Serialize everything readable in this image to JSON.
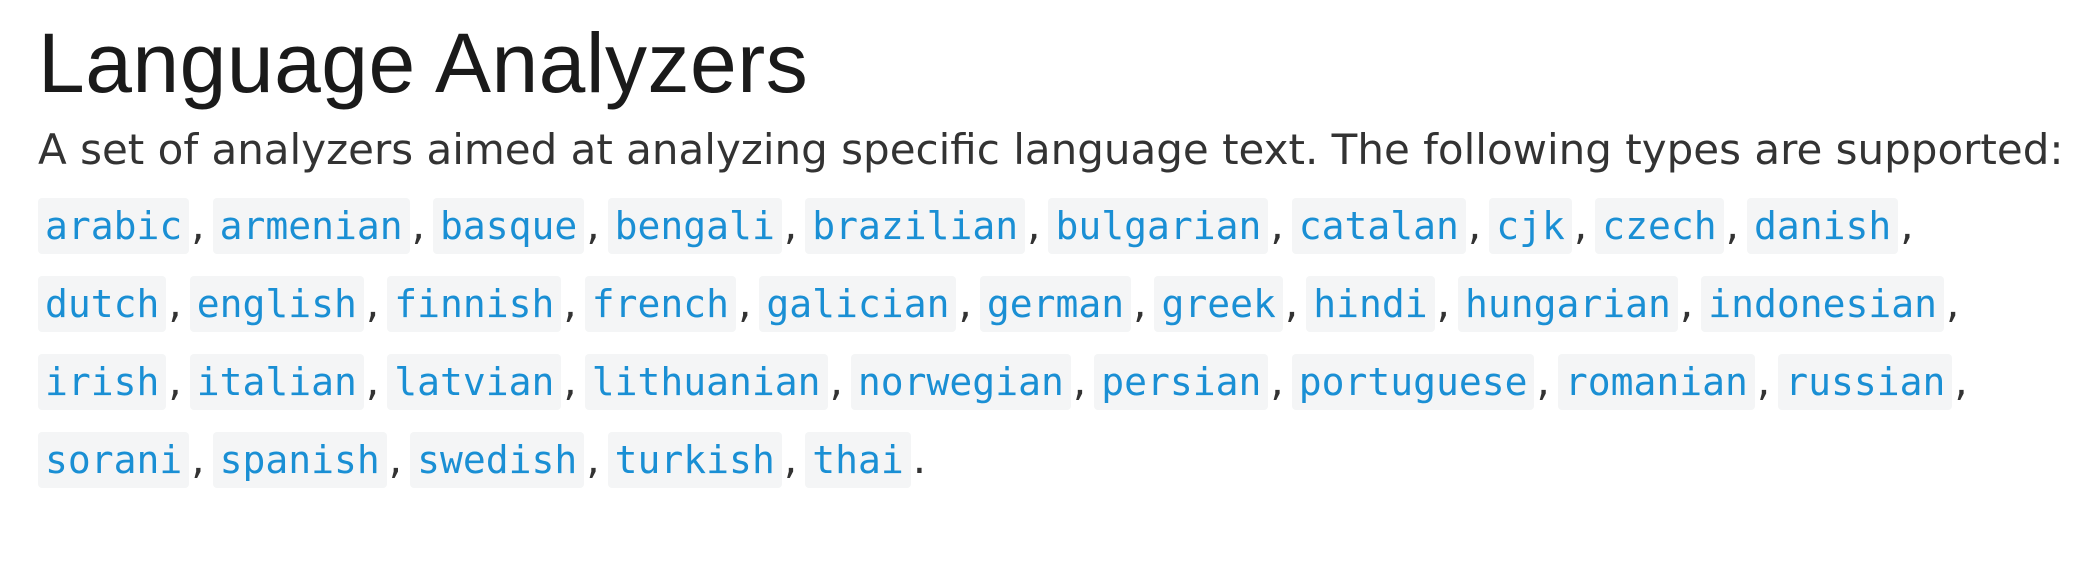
{
  "page": {
    "title": "Language Analyzers",
    "intro": "A set of analyzers aimed at analyzing specific language text. The following types are supported:"
  },
  "types": [
    "arabic",
    "armenian",
    "basque",
    "bengali",
    "brazilian",
    "bulgarian",
    "catalan",
    "cjk",
    "czech",
    "danish",
    "dutch",
    "english",
    "finnish",
    "french",
    "galician",
    "german",
    "greek",
    "hindi",
    "hungarian",
    "indonesian",
    "irish",
    "italian",
    "latvian",
    "lithuanian",
    "norwegian",
    "persian",
    "portuguese",
    "romanian",
    "russian",
    "sorani",
    "spanish",
    "swedish",
    "turkish",
    "thai"
  ],
  "punctuation": {
    "separator": ",",
    "terminator": "."
  },
  "colors": {
    "link": "#1a8fd4",
    "code_background": "#f4f5f6",
    "text": "#333333",
    "title": "#1a1a1a"
  }
}
